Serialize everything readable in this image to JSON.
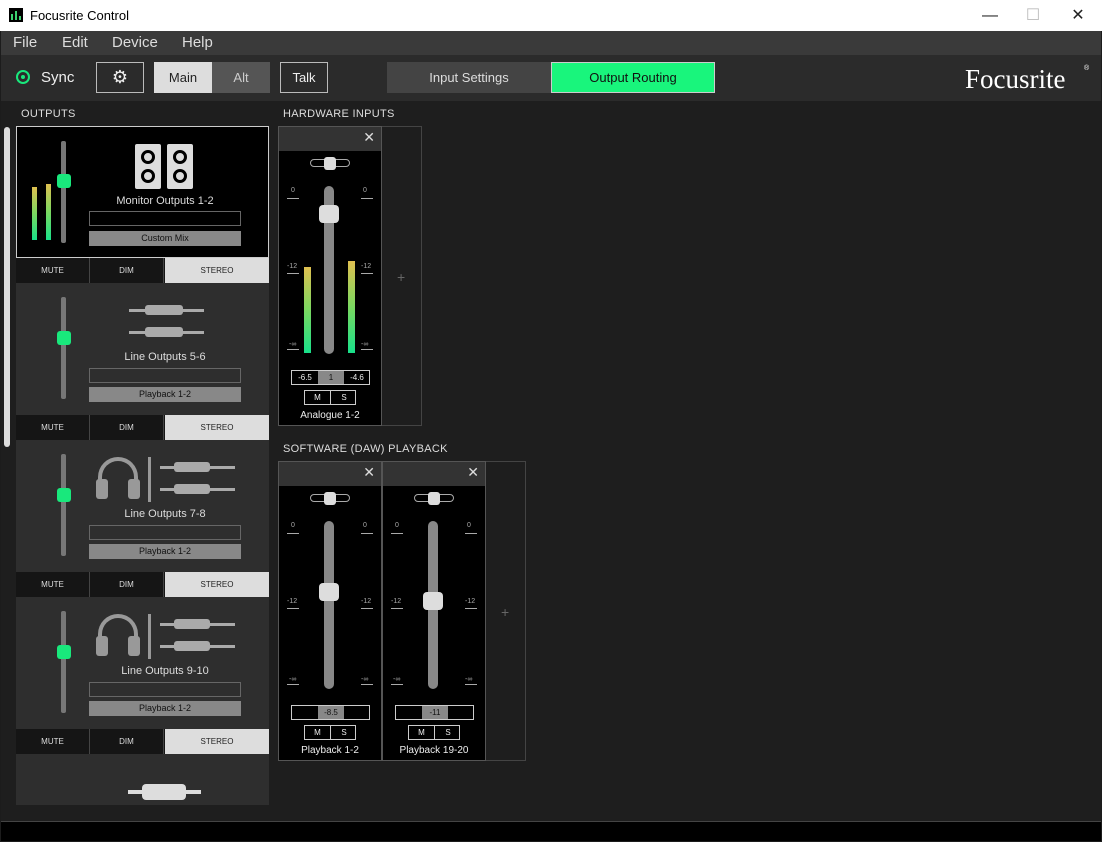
{
  "window": {
    "title": "Focusrite Control",
    "minimize": "—",
    "maximize": "☐",
    "close": "✕"
  },
  "menu": [
    "File",
    "Edit",
    "Device",
    "Help"
  ],
  "toolbar": {
    "sync": "Sync",
    "main": "Main",
    "alt": "Alt",
    "talk": "Talk",
    "input_settings": "Input Settings",
    "output_routing": "Output Routing",
    "logo": "Focusrite",
    "logo_mark": "®",
    "accent": "#19f57c"
  },
  "outputs": {
    "header": "OUTPUTS",
    "buttons": {
      "mute": "MUTE",
      "dim": "DIM",
      "stereo": "STEREO"
    },
    "panels": [
      {
        "name": "Monitor Outputs 1-2",
        "source": "Custom Mix",
        "icon": "speakers-icon"
      },
      {
        "name": "Line Outputs 5-6",
        "source": "Playback 1-2",
        "icon": "jack-cables-icon"
      },
      {
        "name": "Line Outputs 7-8",
        "source": "Playback 1-2",
        "icon": "headphones-icon"
      },
      {
        "name": "Line Outputs 9-10",
        "source": "Playback 1-2",
        "icon": "headphones-icon"
      }
    ]
  },
  "hardware_inputs": {
    "header": "HARDWARE INPUTS",
    "channels": [
      {
        "name": "Analogue 1-2",
        "left": "-6.5",
        "mid": "1",
        "right": "-4.6"
      }
    ]
  },
  "software_playback": {
    "header": "SOFTWARE (DAW) PLAYBACK",
    "channels": [
      {
        "name": "Playback 1-2",
        "value": "-8.5"
      },
      {
        "name": "Playback 19-20",
        "value": "-11"
      }
    ]
  },
  "scale": {
    "top": "0",
    "mid": "-12",
    "bottom": "-∞"
  },
  "ms": {
    "m": "M",
    "s": "S"
  },
  "close_x": "✕",
  "plus": "+"
}
